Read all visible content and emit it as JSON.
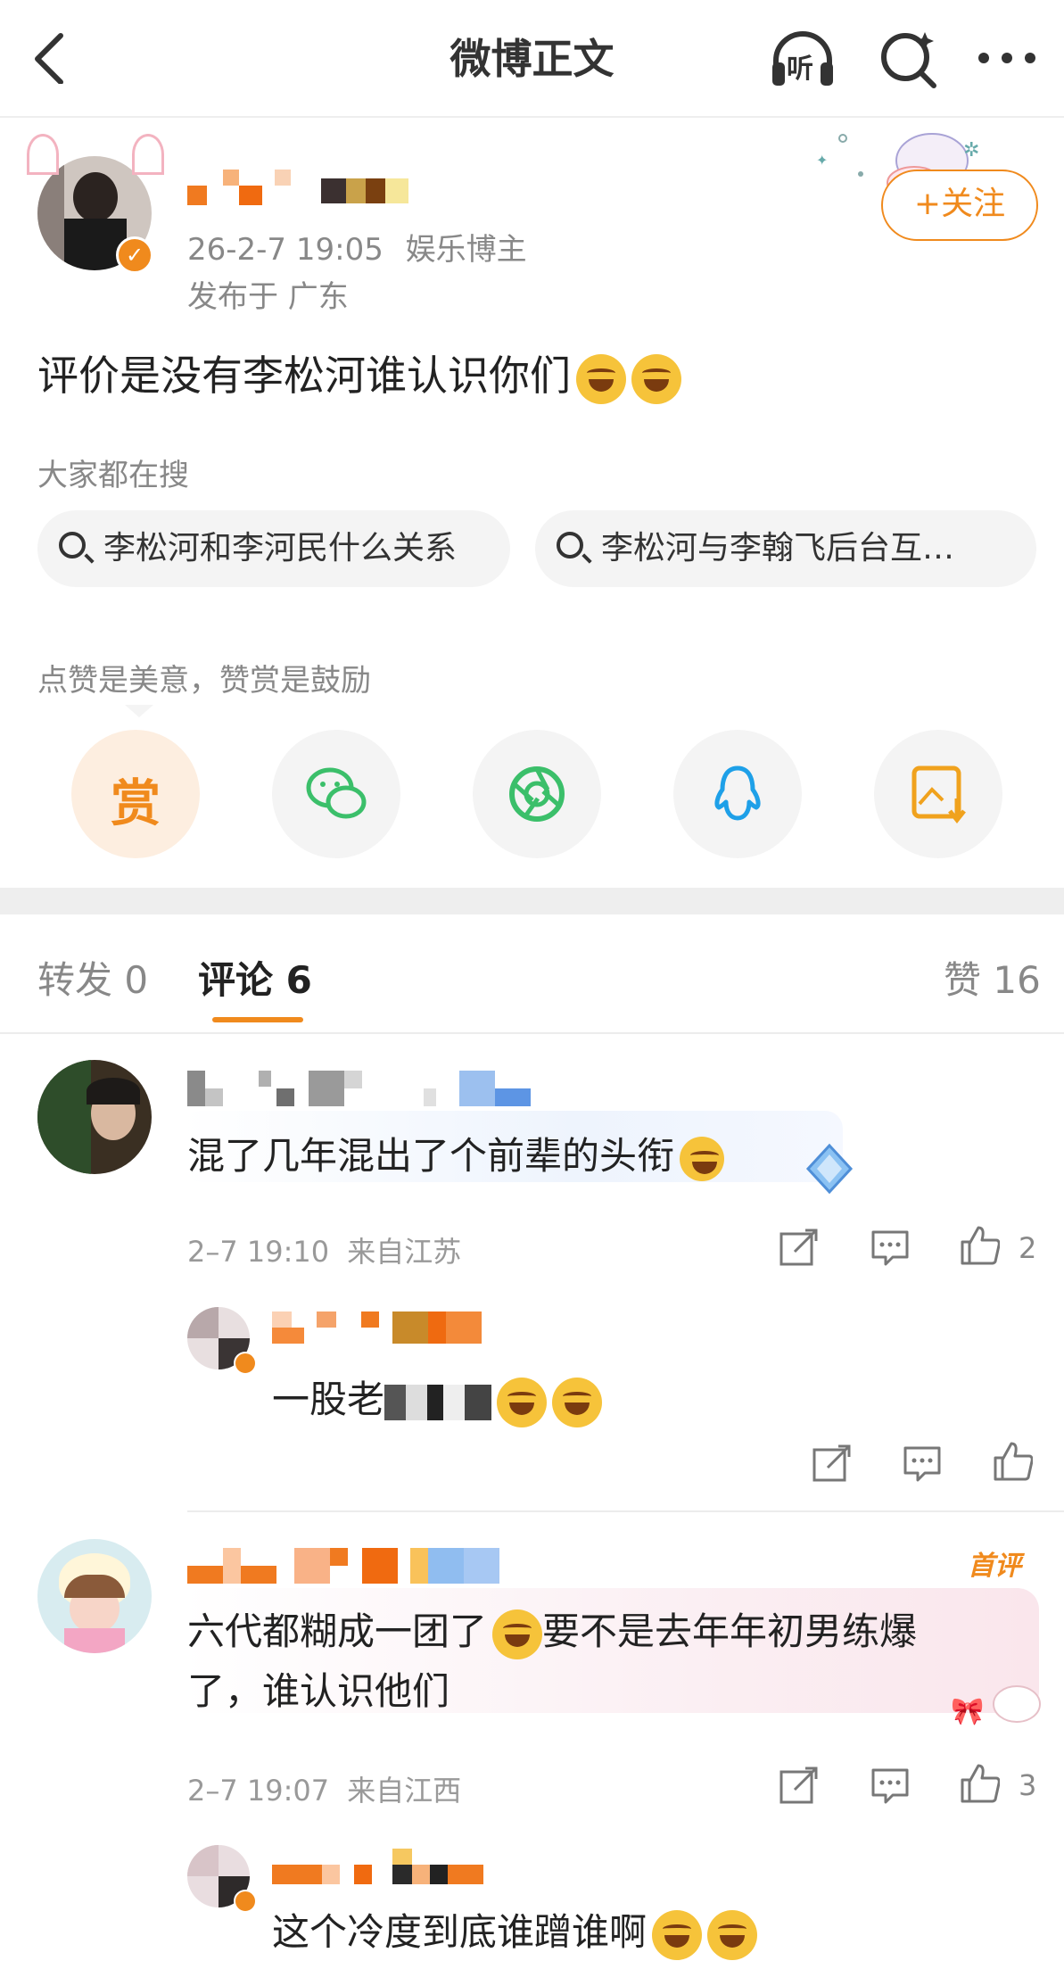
{
  "header": {
    "title": "微博正文",
    "back_icon": "back-icon",
    "listen_label": "听",
    "search_icon": "search-icon",
    "more_icon": "more-icon"
  },
  "post": {
    "time": "26-2-7 19:05",
    "author_tag": "娱乐博主",
    "location": "发布于 广东",
    "follow_label": "+关注",
    "text": "评价是没有李松河谁认识你们"
  },
  "search_section": {
    "label": "大家都在搜",
    "chips": [
      "李松河和李河民什么关系",
      "李松河与李翰飞后台互…"
    ]
  },
  "reward_section": {
    "label": "点赞是美意，赞赏是鼓励",
    "reward_label": "赏",
    "share_icons": [
      "reward-icon",
      "wechat-icon",
      "moments-icon",
      "qq-icon",
      "save-image-icon"
    ]
  },
  "tabs": {
    "repost": "转发 0",
    "comment": "评论 6",
    "like": "赞 16"
  },
  "comments": [
    {
      "text": "混了几年混出了个前辈的头衔",
      "time": "2–7 19:10",
      "from": "来自江苏",
      "likes": "2",
      "reply": {
        "text": "一股老"
      }
    },
    {
      "badge": "首评",
      "text_line1": "六代都糊成一团了",
      "text_line1b": "要不是去年年初男练爆",
      "text_line2": "了，谁认识他们",
      "time": "2–7 19:07",
      "from": "来自江西",
      "likes": "3",
      "reply": {
        "text": "这个冷度到底谁蹭谁啊"
      }
    }
  ],
  "colors": {
    "accent": "#f08a1d",
    "gray_text": "#888888"
  }
}
